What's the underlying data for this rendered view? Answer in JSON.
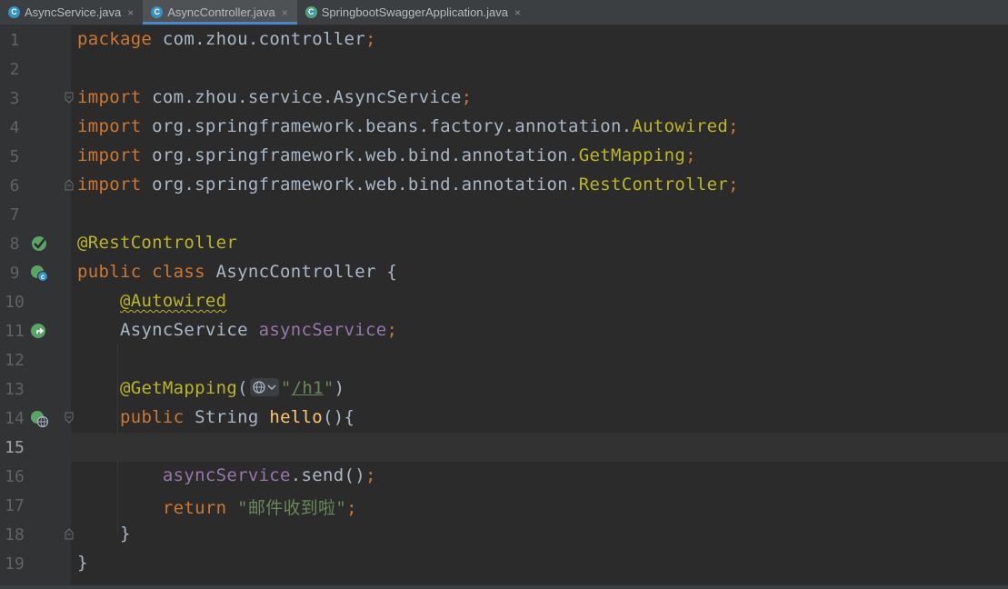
{
  "tabs": [
    {
      "name": "AsyncService.java",
      "icon": "C",
      "active": false
    },
    {
      "name": "AsyncController.java",
      "icon": "C",
      "active": true
    },
    {
      "name": "SpringbootSwaggerApplication.java",
      "icon": "C",
      "active": false
    }
  ],
  "close_glyph": "×",
  "colors": {
    "keyword": "#cc7832",
    "annotation": "#bbb529",
    "field": "#9876aa",
    "string": "#6a8759",
    "method": "#ffc66d",
    "plain": "#a9b7c6",
    "background": "#2b2b2b"
  },
  "lines": {
    "n1": "1",
    "n2": "2",
    "n3": "3",
    "n4": "4",
    "n5": "5",
    "n6": "6",
    "n7": "7",
    "n8": "8",
    "n9": "9",
    "n10": "10",
    "n11": "11",
    "n12": "12",
    "n13": "13",
    "n14": "14",
    "n15": "15",
    "n16": "16",
    "n17": "17",
    "n18": "18",
    "n19": "19"
  },
  "code": {
    "l1_kw": "package",
    "l1_rest": " com.zhou.controller",
    "l1_semi": ";",
    "l3_kw": "import",
    "l3_rest": " com.zhou.service.AsyncService",
    "l3_semi": ";",
    "l4_kw": "import",
    "l4_rest": " org.springframework.beans.factory.annotation.",
    "l4_ann": "Autowired",
    "l4_semi": ";",
    "l5_kw": "import",
    "l5_rest": " org.springframework.web.bind.annotation.",
    "l5_ann": "GetMapping",
    "l5_semi": ";",
    "l6_kw": "import",
    "l6_rest": " org.springframework.web.bind.annotation.",
    "l6_ann": "RestController",
    "l6_semi": ";",
    "l8_ann": "@RestController",
    "l9_kw": "public class",
    "l9_rest": " AsyncController {",
    "l10_ann": "@Autowired",
    "l11_type": "AsyncService ",
    "l11_fld": "asyncService",
    "l11_semi": ";",
    "l13_ann": "@GetMapping",
    "l13_paren": "(",
    "l13_q1": "\"",
    "l13_path": "/h1",
    "l13_q2": "\"",
    "l13_close": ")",
    "l14_kw": "public",
    "l14_type": " String ",
    "l14_fn": "hello",
    "l14_rest": "(){",
    "l16_fld": "asyncService",
    "l16_rest": ".send()",
    "l16_semi": ";",
    "l17_kw": "return ",
    "l17_str": "\"邮件收到啦\"",
    "l17_semi": ";",
    "l18_brace": "}",
    "l19_brace": "}"
  }
}
